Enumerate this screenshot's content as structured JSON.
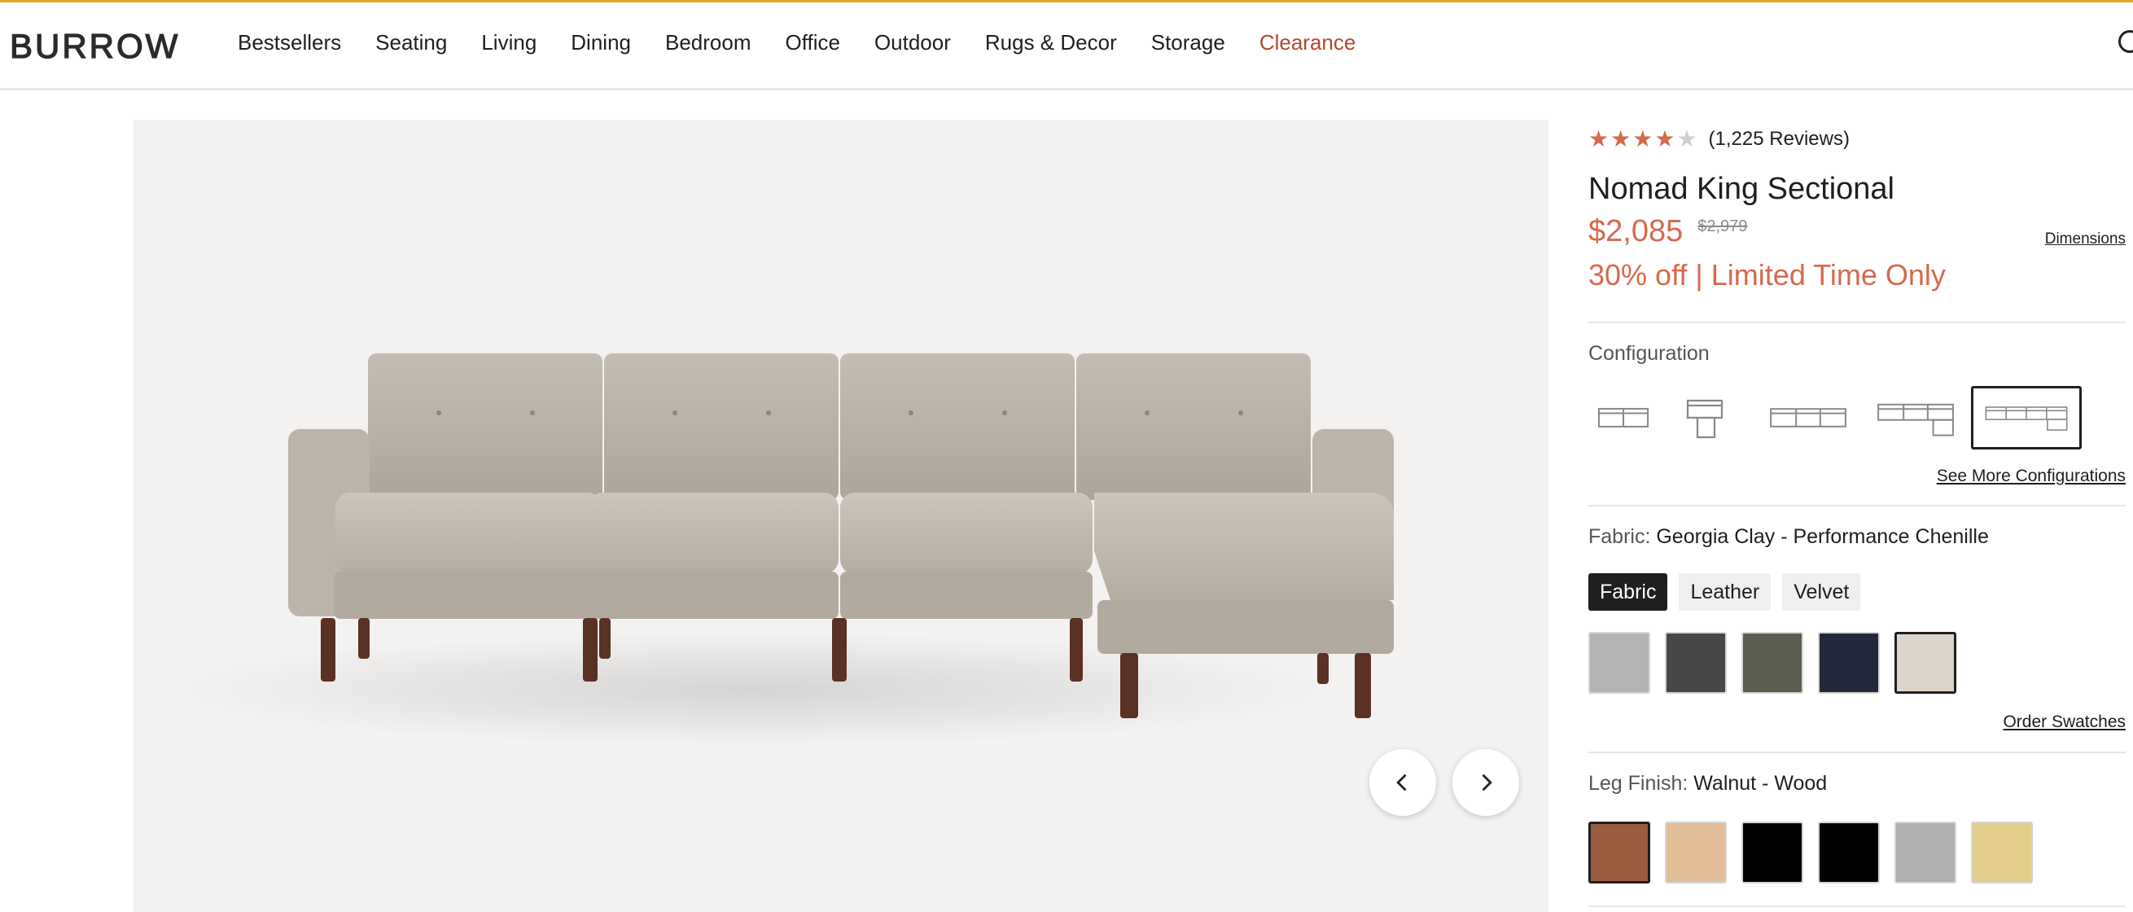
{
  "brand": {
    "logo": "BURROW"
  },
  "nav": {
    "items": [
      {
        "label": "Bestsellers"
      },
      {
        "label": "Seating"
      },
      {
        "label": "Living"
      },
      {
        "label": "Dining"
      },
      {
        "label": "Bedroom"
      },
      {
        "label": "Office"
      },
      {
        "label": "Outdoor"
      },
      {
        "label": "Rugs & Decor"
      },
      {
        "label": "Storage"
      },
      {
        "label": "Clearance"
      }
    ]
  },
  "colors": {
    "accent_line": "#e2a52c",
    "sale": "#d56a4d",
    "clearance": "#b2492c"
  },
  "product": {
    "rating": 4,
    "rating_max": 5,
    "reviews": "(1,225 Reviews)",
    "title": "Nomad King Sectional",
    "price": "$2,085",
    "old_price": "$2,979",
    "dimensions_link": "Dimensions",
    "promo": "30% off | Limited Time Only"
  },
  "configuration": {
    "label": "Configuration",
    "options": [
      "loveseat",
      "chair-ottoman",
      "sofa",
      "sectional",
      "king-sectional"
    ],
    "selected_index": 4,
    "more_link": "See More Configurations"
  },
  "fabric": {
    "label": "Fabric:",
    "value": "Georgia Clay - Performance Chenille",
    "tabs": [
      "Fabric",
      "Leather",
      "Velvet"
    ],
    "active_tab": 0,
    "swatches": [
      "#b3b3b3",
      "#474747",
      "#5b5e4f",
      "#23283a",
      "#ddd4ca"
    ],
    "selected_swatch": 4,
    "order_link": "Order Swatches"
  },
  "leg_finish": {
    "label": "Leg Finish:",
    "value": "Walnut - Wood",
    "swatches": [
      "#9a5d3f",
      "#e2bd98",
      "#000000",
      "#000000",
      "#b0b0b2",
      "#e3cd8a"
    ],
    "selected_swatch": 0
  },
  "gallery": {
    "prev_icon": "chevron-left-icon",
    "next_icon": "chevron-right-icon"
  }
}
